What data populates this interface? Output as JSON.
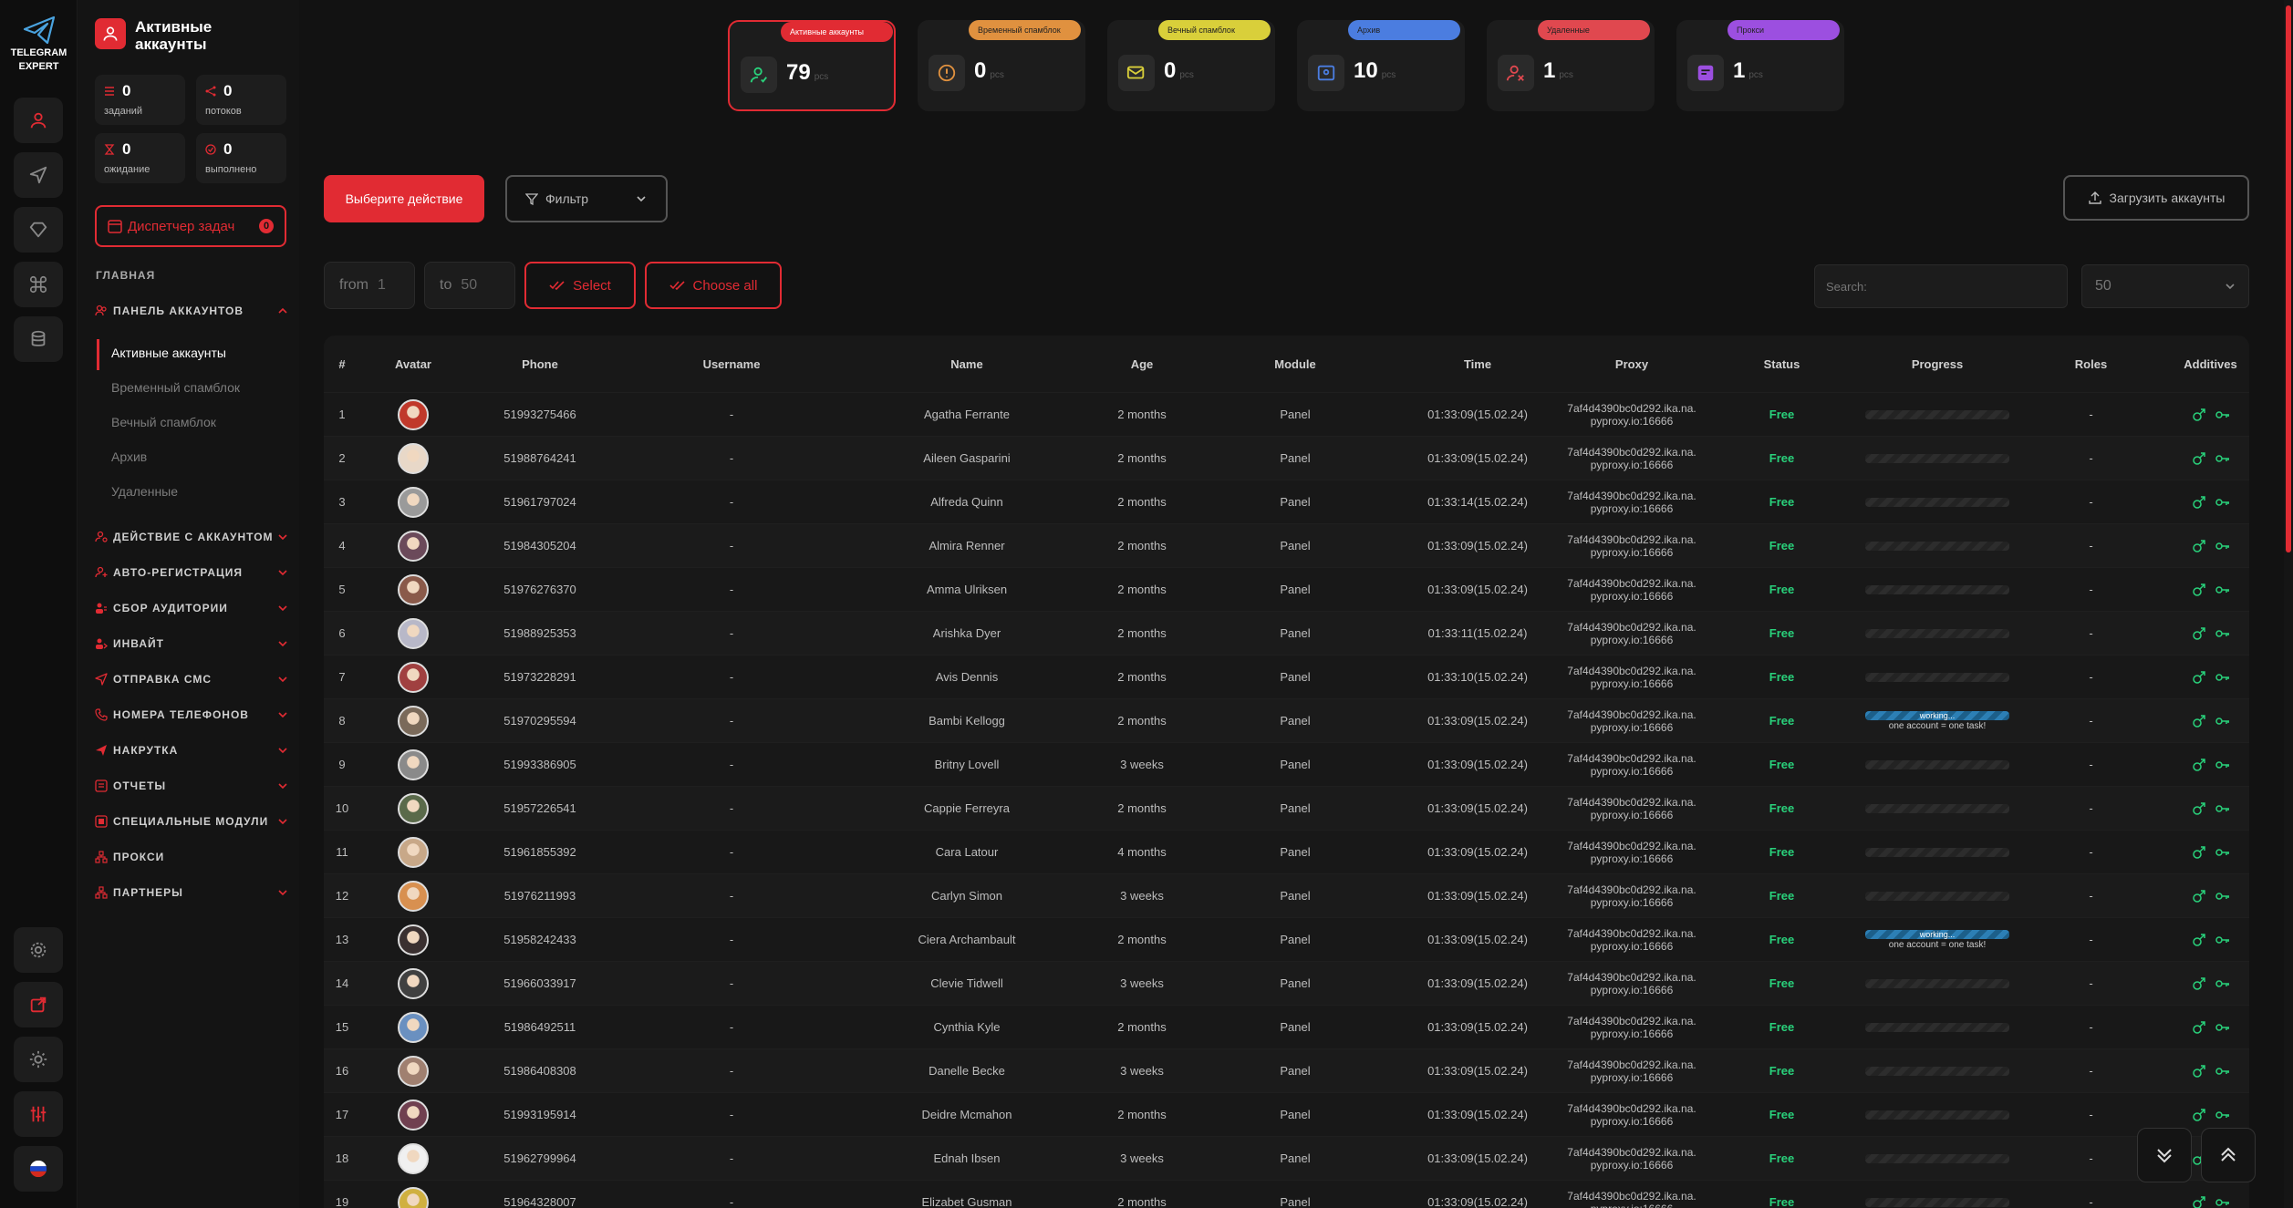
{
  "brand": {
    "name_line1": "TELEGRAM",
    "name_line2": "EXPERT"
  },
  "sidebar": {
    "title_line1": "Активные",
    "title_line2": "аккаунты",
    "stats": [
      {
        "value": "0",
        "label": "заданий"
      },
      {
        "value": "0",
        "label": "потоков"
      },
      {
        "value": "0",
        "label": "ожидание"
      },
      {
        "value": "0",
        "label": "выполнено"
      }
    ],
    "dispatcher": {
      "label": "Диспетчер задач",
      "badge": "0"
    },
    "section": "ГЛАВНАЯ",
    "accounts_panel": "ПАНЕЛЬ АККАУНТОВ",
    "sub_items": [
      "Активные аккаунты",
      "Временный спамблок",
      "Вечный спамблок",
      "Архив",
      "Удаленные"
    ],
    "menu": [
      "ДЕЙСТВИЕ С АККАУНТОМ",
      "АВТО-РЕГИСТРАЦИЯ",
      "СБОР АУДИТОРИИ",
      "ИНВАЙТ",
      "ОТПРАВКА СМС",
      "НОМЕРА ТЕЛЕФОНОВ",
      "НАКРУТКА",
      "ОТЧЕТЫ",
      "СПЕЦИАЛЬНЫЕ МОДУЛИ",
      "ПРОКСИ",
      "ПАРТНЕРЫ"
    ]
  },
  "cards": [
    {
      "tag": "Активные аккаунты",
      "value": "79",
      "unit": "pcs",
      "color": "#e12b33",
      "icon": "user-check-icon"
    },
    {
      "tag": "Временный спамблок",
      "value": "0",
      "unit": "pcs",
      "color": "#e0913f",
      "icon": "alert-icon"
    },
    {
      "tag": "Вечный спамблок",
      "value": "0",
      "unit": "pcs",
      "color": "#d9cf3a",
      "icon": "mail-block-icon"
    },
    {
      "tag": "Архив",
      "value": "10",
      "unit": "pcs",
      "color": "#4b7de0",
      "icon": "archive-icon"
    },
    {
      "tag": "Удаленные",
      "value": "1",
      "unit": "pcs",
      "color": "#e0484f",
      "icon": "user-x-icon"
    },
    {
      "tag": "Прокси",
      "value": "1",
      "unit": "pcs",
      "color": "#9c4fe0",
      "icon": "proxy-icon"
    }
  ],
  "actions": {
    "select_action": "Выберите действие",
    "filter": "Фильтр",
    "upload": "Загрузить аккаунты"
  },
  "range": {
    "from_label": "from",
    "from_value": "1",
    "to_label": "to",
    "to_value": "50",
    "select": "Select",
    "choose_all": "Choose all"
  },
  "search": {
    "placeholder": "Search:"
  },
  "page_size": "50",
  "table": {
    "headers": [
      "#",
      "Avatar",
      "Phone",
      "Username",
      "Name",
      "Age",
      "Module",
      "Time",
      "Proxy",
      "Status",
      "Progress",
      "Roles",
      "Additives"
    ],
    "proxy_line1": "7af4d4390bc0d292.ika.na.",
    "proxy_line2": "pyproxy.io:16666",
    "working_text": "working...",
    "working_note": "one account = one task!",
    "rows": [
      {
        "n": "1",
        "phone": "51993275466",
        "username": "-",
        "name": "Agatha Ferrante",
        "age": "2 months",
        "module": "Panel",
        "time": "01:33:09(15.02.24)",
        "status": "Free",
        "working": false,
        "roles": "-",
        "color": "#c0392b"
      },
      {
        "n": "2",
        "phone": "51988764241",
        "username": "-",
        "name": "Aileen Gasparini",
        "age": "2 months",
        "module": "Panel",
        "time": "01:33:09(15.02.24)",
        "status": "Free",
        "working": false,
        "roles": "-",
        "color": "#e8d8c8"
      },
      {
        "n": "3",
        "phone": "51961797024",
        "username": "-",
        "name": "Alfreda Quinn",
        "age": "2 months",
        "module": "Panel",
        "time": "01:33:14(15.02.24)",
        "status": "Free",
        "working": false,
        "roles": "-",
        "color": "#9a9a9a"
      },
      {
        "n": "4",
        "phone": "51984305204",
        "username": "-",
        "name": "Almira Renner",
        "age": "2 months",
        "module": "Panel",
        "time": "01:33:09(15.02.24)",
        "status": "Free",
        "working": false,
        "roles": "-",
        "color": "#6b4a5a"
      },
      {
        "n": "5",
        "phone": "51976276370",
        "username": "-",
        "name": "Amma Ulriksen",
        "age": "2 months",
        "module": "Panel",
        "time": "01:33:09(15.02.24)",
        "status": "Free",
        "working": false,
        "roles": "-",
        "color": "#8a5a4a"
      },
      {
        "n": "6",
        "phone": "51988925353",
        "username": "-",
        "name": "Arishka Dyer",
        "age": "2 months",
        "module": "Panel",
        "time": "01:33:11(15.02.24)",
        "status": "Free",
        "working": false,
        "roles": "-",
        "color": "#b8b8c8"
      },
      {
        "n": "7",
        "phone": "51973228291",
        "username": "-",
        "name": "Avis Dennis",
        "age": "2 months",
        "module": "Panel",
        "time": "01:33:10(15.02.24)",
        "status": "Free",
        "working": false,
        "roles": "-",
        "color": "#a04040"
      },
      {
        "n": "8",
        "phone": "51970295594",
        "username": "-",
        "name": "Bambi Kellogg",
        "age": "2 months",
        "module": "Panel",
        "time": "01:33:09(15.02.24)",
        "status": "Free",
        "working": true,
        "roles": "-",
        "color": "#7a6a5a"
      },
      {
        "n": "9",
        "phone": "51993386905",
        "username": "-",
        "name": "Britny Lovell",
        "age": "3 weeks",
        "module": "Panel",
        "time": "01:33:09(15.02.24)",
        "status": "Free",
        "working": false,
        "roles": "-",
        "color": "#8a8a8a"
      },
      {
        "n": "10",
        "phone": "51957226541",
        "username": "-",
        "name": "Cappie Ferreyra",
        "age": "2 months",
        "module": "Panel",
        "time": "01:33:09(15.02.24)",
        "status": "Free",
        "working": false,
        "roles": "-",
        "color": "#5a6a4a"
      },
      {
        "n": "11",
        "phone": "51961855392",
        "username": "-",
        "name": "Cara Latour",
        "age": "4 months",
        "module": "Panel",
        "time": "01:33:09(15.02.24)",
        "status": "Free",
        "working": false,
        "roles": "-",
        "color": "#c8a888"
      },
      {
        "n": "12",
        "phone": "51976211993",
        "username": "-",
        "name": "Carlyn Simon",
        "age": "3 weeks",
        "module": "Panel",
        "time": "01:33:09(15.02.24)",
        "status": "Free",
        "working": false,
        "roles": "-",
        "color": "#d89050"
      },
      {
        "n": "13",
        "phone": "51958242433",
        "username": "-",
        "name": "Ciera Archambault",
        "age": "2 months",
        "module": "Panel",
        "time": "01:33:09(15.02.24)",
        "status": "Free",
        "working": true,
        "roles": "-",
        "color": "#3a3030"
      },
      {
        "n": "14",
        "phone": "51966033917",
        "username": "-",
        "name": "Clevie Tidwell",
        "age": "3 weeks",
        "module": "Panel",
        "time": "01:33:09(15.02.24)",
        "status": "Free",
        "working": false,
        "roles": "-",
        "color": "#404040"
      },
      {
        "n": "15",
        "phone": "51986492511",
        "username": "-",
        "name": "Cynthia Kyle",
        "age": "2 months",
        "module": "Panel",
        "time": "01:33:09(15.02.24)",
        "status": "Free",
        "working": false,
        "roles": "-",
        "color": "#6a90c0"
      },
      {
        "n": "16",
        "phone": "51986408308",
        "username": "-",
        "name": "Danelle Becke",
        "age": "3 weeks",
        "module": "Panel",
        "time": "01:33:09(15.02.24)",
        "status": "Free",
        "working": false,
        "roles": "-",
        "color": "#a08070"
      },
      {
        "n": "17",
        "phone": "51993195914",
        "username": "-",
        "name": "Deidre Mcmahon",
        "age": "2 months",
        "module": "Panel",
        "time": "01:33:09(15.02.24)",
        "status": "Free",
        "working": false,
        "roles": "-",
        "color": "#704050"
      },
      {
        "n": "18",
        "phone": "51962799964",
        "username": "-",
        "name": "Ednah Ibsen",
        "age": "3 weeks",
        "module": "Panel",
        "time": "01:33:09(15.02.24)",
        "status": "Free",
        "working": false,
        "roles": "-",
        "color": "#f0f0f0"
      },
      {
        "n": "19",
        "phone": "51964328007",
        "username": "-",
        "name": "Elizabet Gusman",
        "age": "2 months",
        "module": "Panel",
        "time": "01:33:09(15.02.24)",
        "status": "Free",
        "working": false,
        "roles": "-",
        "color": "#d0b040"
      }
    ]
  }
}
